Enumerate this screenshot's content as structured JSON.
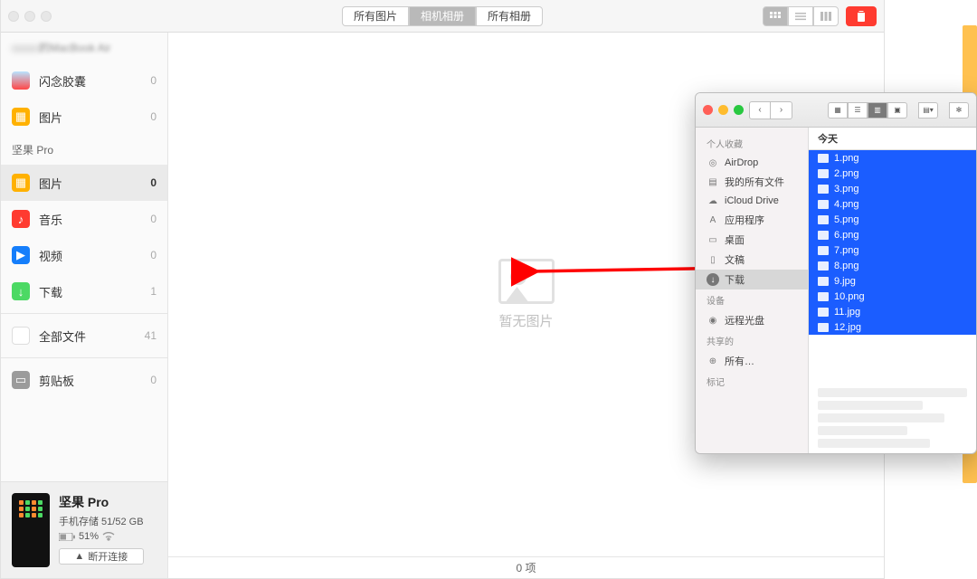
{
  "colors": {
    "red": "#ff3b30",
    "orange": "#ffb100",
    "blue": "#1b5dff",
    "accent_tab": "#b9b9b9"
  },
  "title_tabs": [
    {
      "label": "所有图片",
      "active": false
    },
    {
      "label": "相机相册",
      "active": true
    },
    {
      "label": "所有相册",
      "active": false
    }
  ],
  "sidebar": {
    "section1": "的MacBook Air",
    "section2": "坚果 Pro",
    "items1": [
      {
        "icon": "capsule",
        "label": "闪念胶囊",
        "count": "0"
      },
      {
        "icon": "photo",
        "label": "图片",
        "count": "0"
      }
    ],
    "items2": [
      {
        "icon": "photo",
        "label": "图片",
        "count": "0",
        "selected": true
      },
      {
        "icon": "music",
        "label": "音乐",
        "count": "0"
      },
      {
        "icon": "video",
        "label": "视频",
        "count": "0"
      },
      {
        "icon": "download",
        "label": "下载",
        "count": "1"
      },
      {
        "icon": "files",
        "label": "全部文件",
        "count": "41"
      },
      {
        "icon": "clip",
        "label": "剪贴板",
        "count": "0"
      }
    ]
  },
  "device": {
    "name": "坚果 Pro",
    "storage": "手机存储 51/52 GB",
    "battery": "51%",
    "disconnect": "断开连接"
  },
  "empty": "暂无图片",
  "status": "0 项",
  "finder": {
    "sections": {
      "fav": "个人收藏",
      "dev": "设备",
      "share": "共享的",
      "tag": "标记"
    },
    "fav_items": [
      {
        "icon": "airdrop",
        "label": "AirDrop"
      },
      {
        "icon": "allfiles",
        "label": "我的所有文件"
      },
      {
        "icon": "cloud",
        "label": "iCloud Drive"
      },
      {
        "icon": "apps",
        "label": "应用程序"
      },
      {
        "icon": "desktop",
        "label": "桌面"
      },
      {
        "icon": "docs",
        "label": "文稿"
      },
      {
        "icon": "dl",
        "label": "下载",
        "selected": true
      }
    ],
    "dev_item": "远程光盘",
    "share_item": "所有…",
    "column_header": "今天",
    "files": [
      "1.png",
      "2.png",
      "3.png",
      "4.png",
      "5.png",
      "6.png",
      "7.png",
      "8.png",
      "9.jpg",
      "10.png",
      "11.jpg",
      "12.jpg"
    ]
  }
}
